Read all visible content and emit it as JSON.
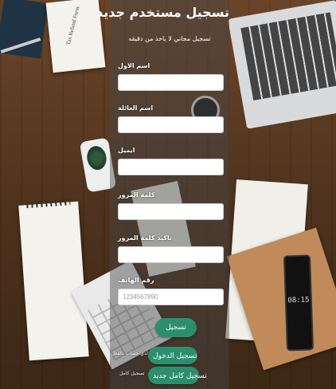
{
  "form": {
    "title": "تسجيل مستخدم جديد",
    "subtitle": "تسجيل مجاني لا ياخذ من دقيقه",
    "fields": [
      {
        "label": "اسم الاول",
        "value": "",
        "placeholder": ""
      },
      {
        "label": "اسم العائلة",
        "value": "",
        "placeholder": ""
      },
      {
        "label": "ايميل",
        "value": "",
        "placeholder": ""
      },
      {
        "label": "كلمة المرور",
        "value": "",
        "placeholder": ""
      },
      {
        "label": "تاكيد كلمة المرور",
        "value": "",
        "placeholder": ""
      },
      {
        "label": "رقم الهاتف",
        "value": "",
        "placeholder": "1234567890"
      }
    ],
    "register_button": "تسجيل",
    "have_account_text": "لدي حساب بالفعل",
    "login_button": "تسجيل الدخول",
    "full_register_text": "تسجيل كامل",
    "full_register_button": "تسجيل كامل جديد"
  },
  "background": {
    "tax_form_text": "Tax Refund Form",
    "phone_clock": "08:15"
  },
  "colors": {
    "button": "#2b8f6e",
    "panel_overlay": "rgba(70,70,70,0.45)"
  }
}
